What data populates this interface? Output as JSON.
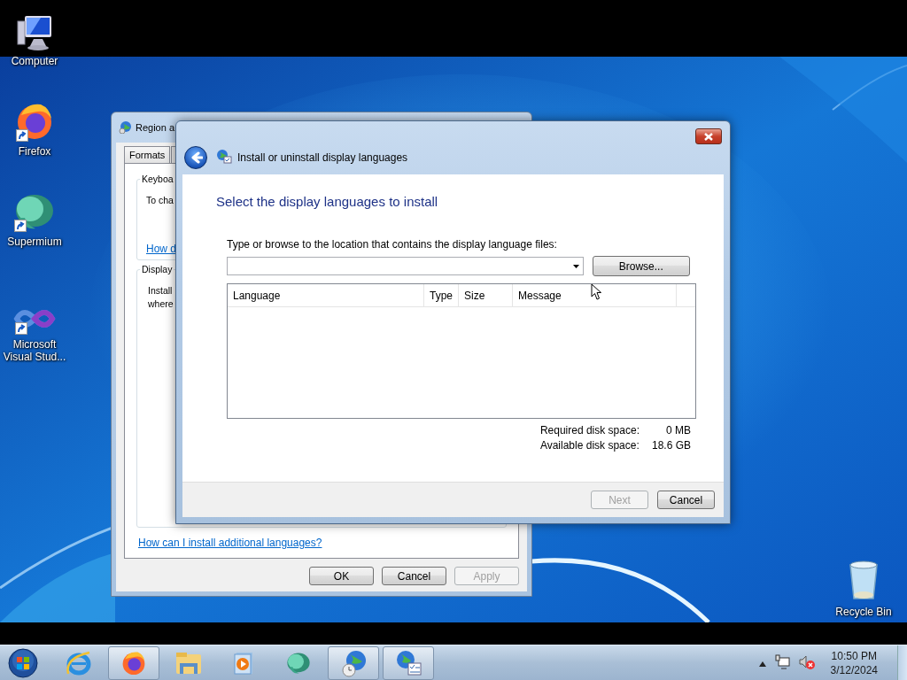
{
  "desktop_icons": [
    {
      "label": "Computer",
      "kind": "computer",
      "shortcut": false
    },
    {
      "label": "Firefox",
      "kind": "firefox",
      "shortcut": true
    },
    {
      "label": "Supermium",
      "kind": "supermium",
      "shortcut": true
    },
    {
      "label": "Microsoft Visual Stud...",
      "kind": "vs",
      "shortcut": true
    },
    {
      "label": "Recycle Bin",
      "kind": "recycle",
      "shortcut": false
    }
  ],
  "region_window": {
    "title": "Region a",
    "tabs": [
      {
        "label": "Formats",
        "selected": false
      }
    ],
    "keyboard_group": {
      "title": "Keyboa",
      "text": "To cha",
      "link": "How d"
    },
    "display_group": {
      "title": "Display",
      "lines": [
        "Install",
        "where"
      ]
    },
    "link": "How can I install additional languages?",
    "buttons": [
      {
        "label": "OK",
        "disabled": false
      },
      {
        "label": "Cancel",
        "disabled": false
      },
      {
        "label": "Apply",
        "disabled": true
      }
    ]
  },
  "install_dialog": {
    "title": "Install or uninstall display languages",
    "heading": "Select the display languages to install",
    "location_label": "Type or browse to the location that contains the display language files:",
    "browse_button": "Browse...",
    "columns": [
      "Language",
      "Type",
      "Size",
      "Message"
    ],
    "disk_space": [
      {
        "label": "Required disk space:",
        "value": "0 MB"
      },
      {
        "label": "Available disk space:",
        "value": "18.6 GB"
      }
    ],
    "buttons": [
      {
        "label": "Next",
        "disabled": true
      },
      {
        "label": "Cancel",
        "disabled": false
      }
    ]
  },
  "taskbar": {
    "items": [
      {
        "kind": "ie",
        "open": false
      },
      {
        "kind": "firefox",
        "open": true
      },
      {
        "kind": "explorer",
        "open": false
      },
      {
        "kind": "media",
        "open": false
      },
      {
        "kind": "supermium",
        "open": false
      },
      {
        "kind": "region",
        "open": true
      },
      {
        "kind": "install",
        "open": true
      }
    ],
    "clock": {
      "time": "10:50 PM",
      "date": "3/12/2024"
    }
  }
}
